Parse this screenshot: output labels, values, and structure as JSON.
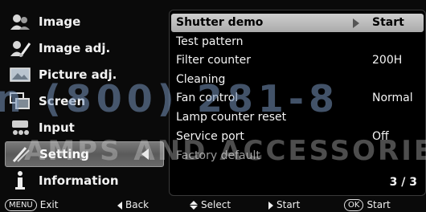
{
  "left_menu": {
    "items": [
      {
        "label": "Image",
        "icon": "people-icon"
      },
      {
        "label": "Image adj.",
        "icon": "image-adjust-icon"
      },
      {
        "label": "Picture adj.",
        "icon": "picture-adjust-icon"
      },
      {
        "label": "Screen",
        "icon": "screen-icon"
      },
      {
        "label": "Input",
        "icon": "input-icon"
      },
      {
        "label": "Setting",
        "icon": "setting-icon",
        "selected": true
      },
      {
        "label": "Information",
        "icon": "information-icon"
      }
    ]
  },
  "right_panel": {
    "rows": [
      {
        "label": "Shutter demo",
        "value": "Start",
        "highlighted": true
      },
      {
        "label": "Test pattern",
        "value": ""
      },
      {
        "label": "Filter counter",
        "value": "200H"
      },
      {
        "label": "Cleaning",
        "value": ""
      },
      {
        "label": "Fan control",
        "value": "Normal"
      },
      {
        "label": "Lamp counter reset",
        "value": ""
      },
      {
        "label": "Service port",
        "value": "Off"
      },
      {
        "label": "Factory default",
        "value": ""
      }
    ],
    "page": "3 / 3"
  },
  "help_bar": {
    "exit_key": "MENU",
    "exit_label": "Exit",
    "back_label": "Back",
    "select_label": "Select",
    "start_label": "Start",
    "ok_key": "OK",
    "ok_label": "Start"
  },
  "watermark": {
    "line1": "n (800) 281-8",
    "line2": "AMPS AND ACCESSORIES"
  },
  "colors": {
    "background": "#0a0a0a",
    "highlight": "#c0c0c0",
    "text": "#f4f4f4"
  }
}
